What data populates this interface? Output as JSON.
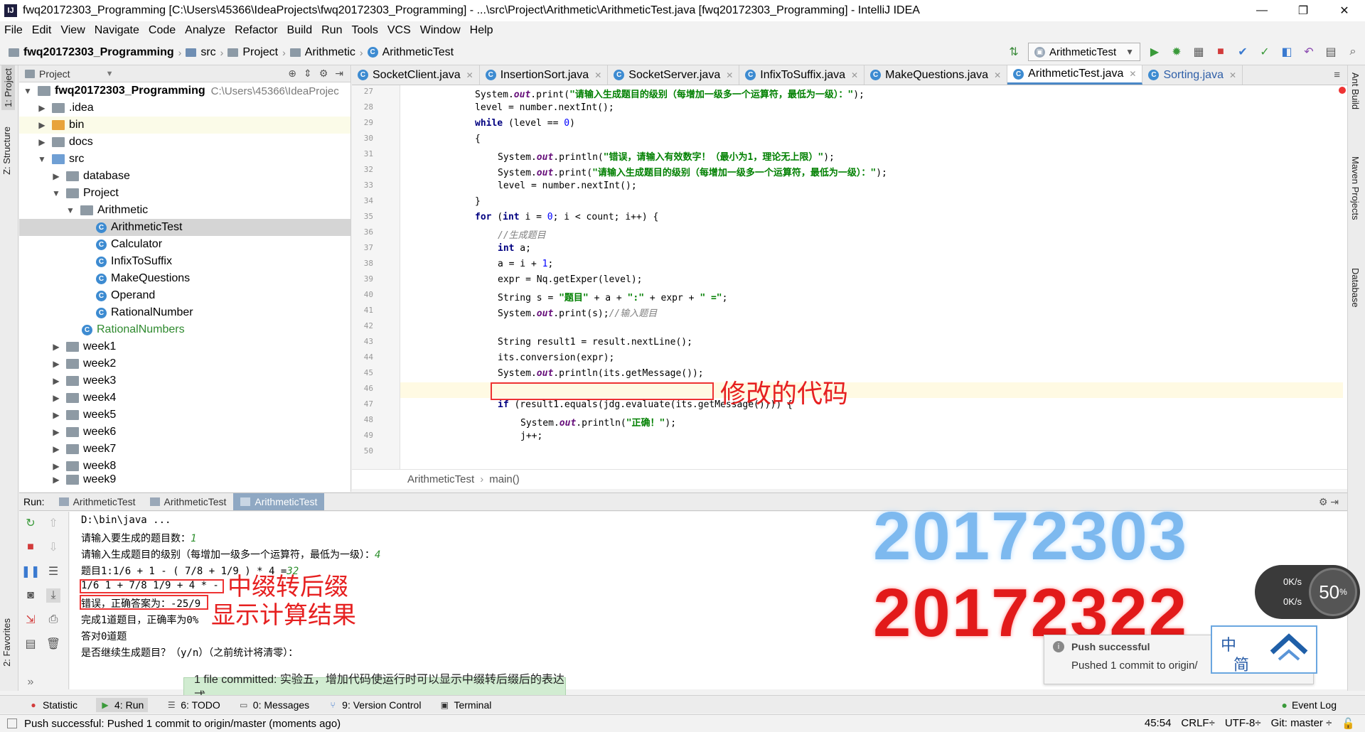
{
  "window": {
    "title": "fwq20172303_Programming [C:\\Users\\45366\\IdeaProjects\\fwq20172303_Programming] - ...\\src\\Project\\Arithmetic\\ArithmeticTest.java [fwq20172303_Programming] - IntelliJ IDEA",
    "minimize": "—",
    "maximize": "❐",
    "close": "✕"
  },
  "menu": [
    "File",
    "Edit",
    "View",
    "Navigate",
    "Code",
    "Analyze",
    "Refactor",
    "Build",
    "Run",
    "Tools",
    "VCS",
    "Window",
    "Help"
  ],
  "navbar": {
    "project": "fwq20172303_Programming",
    "crumbs": [
      "src",
      "Project",
      "Arithmetic",
      "ArithmeticTest"
    ],
    "run_config": "ArithmeticTest"
  },
  "left_strip": {
    "project_tab": "1: Project",
    "structure_tab": "Z: Structure",
    "favorites_tab": "2: Favorites"
  },
  "right_strip": {
    "ant": "Ant Build",
    "maven": "Maven Projects",
    "database": "Database"
  },
  "project_panel": {
    "header": "Project",
    "root_name": "fwq20172303_Programming",
    "root_path": "C:\\Users\\45366\\IdeaProjec",
    "items": [
      ".idea",
      "bin",
      "docs",
      "src",
      "database",
      "Project",
      "Arithmetic",
      "ArithmeticTest",
      "Calculator",
      "InfixToSuffix",
      "MakeQuestions",
      "Operand",
      "RationalNumber",
      "RationalNumbers",
      "week1",
      "week2",
      "week3",
      "week4",
      "week5",
      "week6",
      "week7",
      "week8",
      "week9"
    ]
  },
  "editor_tabs": [
    "SocketClient.java",
    "InsertionSort.java",
    "SocketServer.java",
    "InfixToSuffix.java",
    "MakeQuestions.java",
    "ArithmeticTest.java",
    "Sorting.java"
  ],
  "code": {
    "line_numbers": [
      "27",
      "28",
      "29",
      "30",
      "31",
      "32",
      "33",
      "34",
      "35",
      "36",
      "37",
      "38",
      "39",
      "40",
      "41",
      "42",
      "43",
      "44",
      "45",
      "46",
      "47",
      "48",
      "49",
      "50"
    ],
    "l27a": "System.",
    "l27b": "out",
    "l27c": ".print(",
    "l27d": "\"请输入生成题目的级别（每增加一级多一个运算符，最低为一级）：\"",
    "l27e": ");",
    "l28": "level = number.nextInt();",
    "l29a": "while",
    "l29b": " (level == ",
    "l29c": "0",
    "l29d": ")",
    "l30": "{",
    "l31a": "System.",
    "l31b": "out",
    "l31c": ".println(",
    "l31d": "\"错误，请输入有效数字！（最小为1，理论无上限）\"",
    "l31e": ");",
    "l32a": "System.",
    "l32b": "out",
    "l32c": ".print(",
    "l32d": "\"请输入生成题目的级别（每增加一级多一个运算符，最低为一级）：\"",
    "l32e": ");",
    "l33": "level = number.nextInt();",
    "l34": "}",
    "l35a": "for",
    "l35b": " (",
    "l35c": "int",
    "l35d": " i = ",
    "l35e": "0",
    "l35f": "; i < count; i++) {",
    "l36": "//生成题目",
    "l37a": "int",
    "l37b": " a;",
    "l38a": "a = i + ",
    "l38b": "1",
    "l38c": ";",
    "l39": "expr = Nq.getExper(level);",
    "l40a": "String s = ",
    "l40b": "\"题目\"",
    "l40c": " + a + ",
    "l40d": "\":\"",
    "l40e": " + expr + ",
    "l40f": "\" =\"",
    "l40g": ";",
    "l41a": "System.",
    "l41b": "out",
    "l41c": ".print(s);",
    "l41d": "//输入题目",
    "l43": "String result1 = result.nextLine();",
    "l44": "its.conversion(expr);",
    "l45a": "System.",
    "l45b": "out",
    "l45c": ".println(its.getMessage());",
    "l47a": "if",
    "l47b": " (result1.equals(jdg.evaluate(its.getMessage()))) {",
    "l48a": "System.",
    "l48b": "out",
    "l48c": ".println(",
    "l48d": "\"正确！\"",
    "l48e": ");",
    "l49": "j++;"
  },
  "editor_annotation": "修改的代码",
  "editor_breadcrumb": {
    "cls": "ArithmeticTest",
    "method": "main()"
  },
  "run_panel": {
    "label": "Run:",
    "tabs": [
      "ArithmeticTest",
      "ArithmeticTest",
      "ArithmeticTest"
    ]
  },
  "console": {
    "l1": "D:\\bin\\java ...",
    "l2a": "请输入要生成的题目数：",
    "l2b": "1",
    "l3a": "请输入生成题目的级别（每增加一级多一个运算符，最低为一级）：",
    "l3b": "4",
    "l4a": "题目1:1/6 + 1 - ( 7/8 + 1/9 ) * 4 =",
    "l4b": "32",
    "l5": "1/6 1 + 7/8 1/9 + 4 * -",
    "l6": "错误，正确答案为：-25/9",
    "l7": "完成1道题目，正确率为0%",
    "l8": "答对0道题",
    "l9": "是否继续生成题目？（y/n）（之前统计将清零）："
  },
  "annotations": {
    "infix": "中缀转后缀",
    "result": "显示计算结果"
  },
  "watermark": {
    "id1": "20172303",
    "id2": "20172322"
  },
  "speed_widget": {
    "up": "0K/s",
    "down": "0K/s",
    "percent": "50",
    "percent_unit": "%"
  },
  "notification": {
    "title": "Push successful",
    "body": "Pushed 1 commit to origin/"
  },
  "ime": {
    "c1": "中",
    "c2": "简"
  },
  "commit_balloon": "1 file committed: 实验五，增加代码使运行时可以显示中缀转后缀后的表达式",
  "bottom_tabs": [
    "Statistic",
    "4: Run",
    "6: TODO",
    "0: Messages",
    "9: Version Control",
    "Terminal"
  ],
  "event_log": "Event Log",
  "status": {
    "message": "Push successful: Pushed 1 commit to origin/master (moments ago)",
    "position": "45:54",
    "line_sep": "CRLF÷",
    "encoding": "UTF-8÷",
    "git": "Git: master ÷"
  },
  "colors": {
    "keyword": "#000080",
    "string": "#008000",
    "number": "#0000ff",
    "annotation": "#e62020",
    "watermark_blue": "#7db9ef",
    "watermark_red": "#e21a1a"
  }
}
